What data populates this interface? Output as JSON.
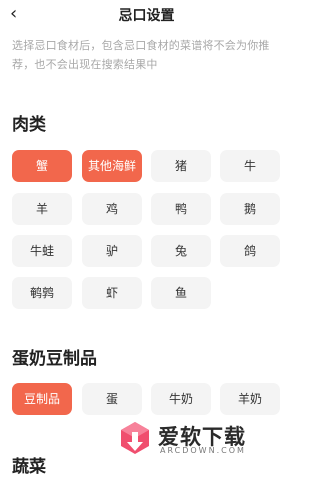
{
  "header": {
    "back_icon": "chevron-left-icon",
    "title": "忌口设置"
  },
  "description": "选择忌口食材后，包含忌口食材的菜谱将不会为你推荐，也不会出现在搜索结果中",
  "sections": {
    "meat": {
      "title": "肉类",
      "items": [
        {
          "label": "蟹",
          "selected": true
        },
        {
          "label": "其他海鲜",
          "selected": true
        },
        {
          "label": "猪",
          "selected": false
        },
        {
          "label": "牛",
          "selected": false
        },
        {
          "label": "羊",
          "selected": false
        },
        {
          "label": "鸡",
          "selected": false
        },
        {
          "label": "鸭",
          "selected": false
        },
        {
          "label": "鹅",
          "selected": false
        },
        {
          "label": "牛蛙",
          "selected": false
        },
        {
          "label": "驴",
          "selected": false
        },
        {
          "label": "兔",
          "selected": false
        },
        {
          "label": "鸽",
          "selected": false
        },
        {
          "label": "鹌鹑",
          "selected": false
        },
        {
          "label": "虾",
          "selected": false
        },
        {
          "label": "鱼",
          "selected": false
        }
      ]
    },
    "dairy": {
      "title": "蛋奶豆制品",
      "items": [
        {
          "label": "豆制品",
          "selected": true
        },
        {
          "label": "蛋",
          "selected": false
        },
        {
          "label": "牛奶",
          "selected": false
        },
        {
          "label": "羊奶",
          "selected": false
        }
      ]
    },
    "veg": {
      "title": "蔬菜"
    }
  },
  "colors": {
    "accent": "#f2674c",
    "chip_bg": "#f4f4f4",
    "hint": "#a8a8a8"
  },
  "watermark": {
    "icon": "download-logo-icon",
    "text": "爱软下载",
    "sub": "ARCDOWN.COM"
  }
}
